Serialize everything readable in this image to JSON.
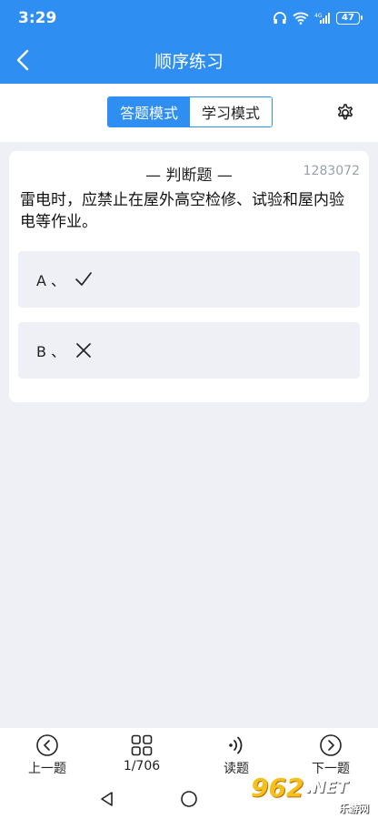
{
  "status": {
    "time": "3:29",
    "battery": "47"
  },
  "header": {
    "title": "顺序练习"
  },
  "modes": {
    "answer_mode": "答题模式",
    "study_mode": "学习模式"
  },
  "question": {
    "type_label": "— 判断题 —",
    "id": "1283072",
    "text": "雷电时，应禁止在屋外高空检修、试验和屋内验电等作业。",
    "options": [
      {
        "letter": "A 、",
        "icon": "check-icon"
      },
      {
        "letter": "B 、",
        "icon": "cross-icon"
      }
    ]
  },
  "bottom_nav": {
    "prev": "上一题",
    "progress": "1/706",
    "read": "读题",
    "next": "下一题"
  },
  "watermark": {
    "logo": "962",
    "net": ".NET",
    "sub": "乐游网"
  },
  "colors": {
    "primary": "#2f8ef1",
    "background": "#eef0f6",
    "option_bg": "#eef0f5"
  }
}
